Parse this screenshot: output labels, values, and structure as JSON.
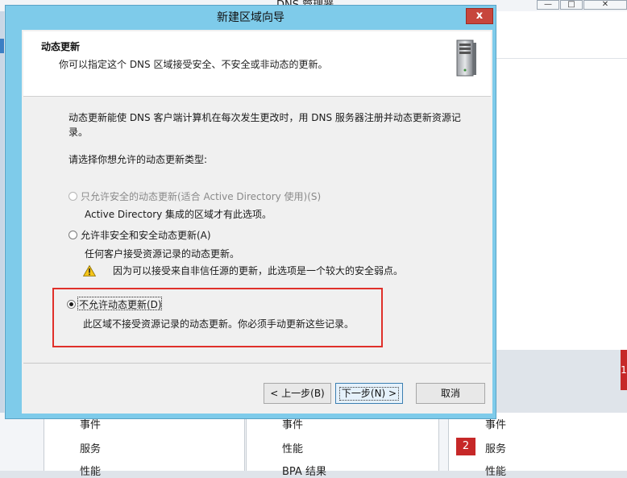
{
  "background": {
    "window_title": "DNS 管理器",
    "controls": {
      "minimize": "—",
      "maximize": "□",
      "close": "✕"
    },
    "red_tab_text": "1",
    "columns": [
      {
        "items": [
          "事件",
          "服务",
          "性能"
        ]
      },
      {
        "items": [
          "事件",
          "性能",
          "BPA 结果"
        ]
      },
      {
        "badge": "2",
        "items": [
          "事件",
          "服务",
          "性能"
        ]
      }
    ]
  },
  "dialog": {
    "title": "新建区域向导",
    "close_symbol": "x",
    "header": {
      "title": "动态更新",
      "subtitle": "你可以指定这个 DNS 区域接受安全、不安全或非动态的更新。",
      "icon": "server-tower-icon"
    },
    "intro_line1": "动态更新能使 DNS 客户端计算机在每次发生更改时，用 DNS 服务器注册并动态更新资源记",
    "intro_line2": "录。",
    "prompt": "请选择你想允许的动态更新类型:",
    "options": [
      {
        "label": "只允许安全的动态更新(适合 Active Directory 使用)(S)",
        "description": "Active Directory 集成的区域才有此选项。",
        "selected": false,
        "enabled": false
      },
      {
        "label": "允许非安全和安全动态更新(A)",
        "description": "任何客户接受资源记录的动态更新。",
        "warning": "因为可以接受来自非信任源的更新，此选项是一个较大的安全弱点。",
        "selected": false,
        "enabled": true
      },
      {
        "label": "不允许动态更新(D)",
        "description": "此区域不接受资源记录的动态更新。你必须手动更新这些记录。",
        "selected": true,
        "enabled": true
      }
    ],
    "buttons": {
      "back": "< 上一步(B)",
      "next": "下一步(N) >",
      "cancel": "取消"
    },
    "colors": {
      "highlight": "#e0302a",
      "frame": "#7ecbea",
      "close": "#c7463c"
    }
  }
}
